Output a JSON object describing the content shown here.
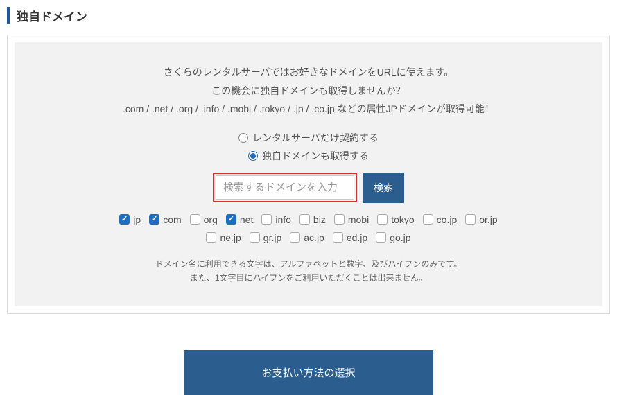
{
  "section": {
    "title": "独自ドメイン"
  },
  "desc": {
    "line1": "さくらのレンタルサーバではお好きなドメインをURLに使えます。",
    "line2": "この機会に独自ドメインも取得しませんか？",
    "line3": ".com / .net / .org / .info / .mobi / .tokyo / .jp / .co.jp などの属性JPドメインが取得可能！"
  },
  "options": {
    "opt1": {
      "label": "レンタルサーバだけ契約する",
      "selected": false
    },
    "opt2": {
      "label": "独自ドメインも取得する",
      "selected": true
    }
  },
  "search": {
    "placeholder": "検索するドメインを入力",
    "button_label": "検索"
  },
  "tlds": [
    {
      "name": "jp",
      "checked": true
    },
    {
      "name": "com",
      "checked": true
    },
    {
      "name": "org",
      "checked": false
    },
    {
      "name": "net",
      "checked": true
    },
    {
      "name": "info",
      "checked": false
    },
    {
      "name": "biz",
      "checked": false
    },
    {
      "name": "mobi",
      "checked": false
    },
    {
      "name": "tokyo",
      "checked": false
    },
    {
      "name": "co.jp",
      "checked": false
    },
    {
      "name": "or.jp",
      "checked": false
    },
    {
      "name": "ne.jp",
      "checked": false
    },
    {
      "name": "gr.jp",
      "checked": false
    },
    {
      "name": "ac.jp",
      "checked": false
    },
    {
      "name": "ed.jp",
      "checked": false
    },
    {
      "name": "go.jp",
      "checked": false
    }
  ],
  "notes": {
    "line1": "ドメイン名に利用できる文字は、アルファベットと数字、及びハイフンのみです。",
    "line2": "また、1文字目にハイフンをご利用いただくことは出来ません。"
  },
  "submit": {
    "label": "お支払い方法の選択"
  }
}
